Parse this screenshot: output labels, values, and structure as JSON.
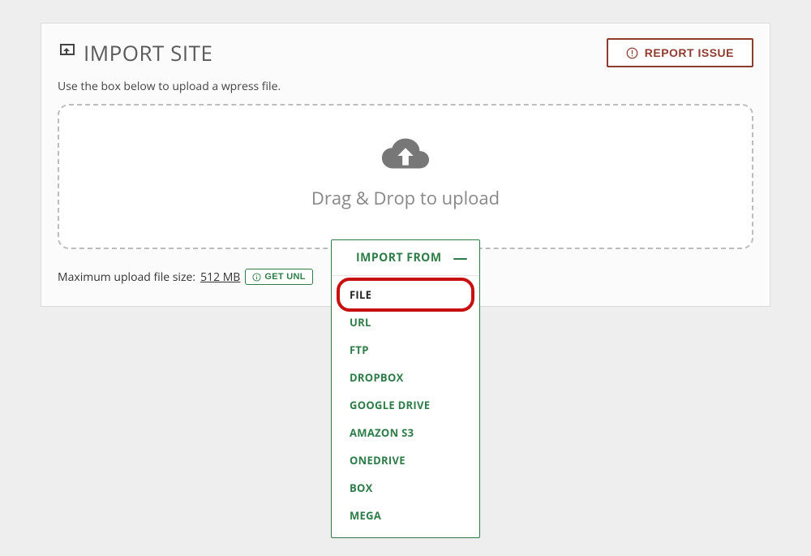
{
  "header": {
    "title": "IMPORT SITE",
    "report_label": "REPORT ISSUE"
  },
  "subtext": "Use the box below to upload a wpress file.",
  "dropzone": {
    "label": "Drag & Drop to upload"
  },
  "importFrom": {
    "header": "IMPORT FROM",
    "items": [
      {
        "label": "FILE",
        "highlighted": true
      },
      {
        "label": "URL"
      },
      {
        "label": "FTP"
      },
      {
        "label": "DROPBOX"
      },
      {
        "label": "GOOGLE DRIVE"
      },
      {
        "label": "AMAZON S3"
      },
      {
        "label": "ONEDRIVE"
      },
      {
        "label": "BOX"
      },
      {
        "label": "MEGA"
      }
    ]
  },
  "footer": {
    "max_label": "Maximum upload file size:",
    "size": "512 MB",
    "get_unlimited_label": "GET UNL"
  }
}
